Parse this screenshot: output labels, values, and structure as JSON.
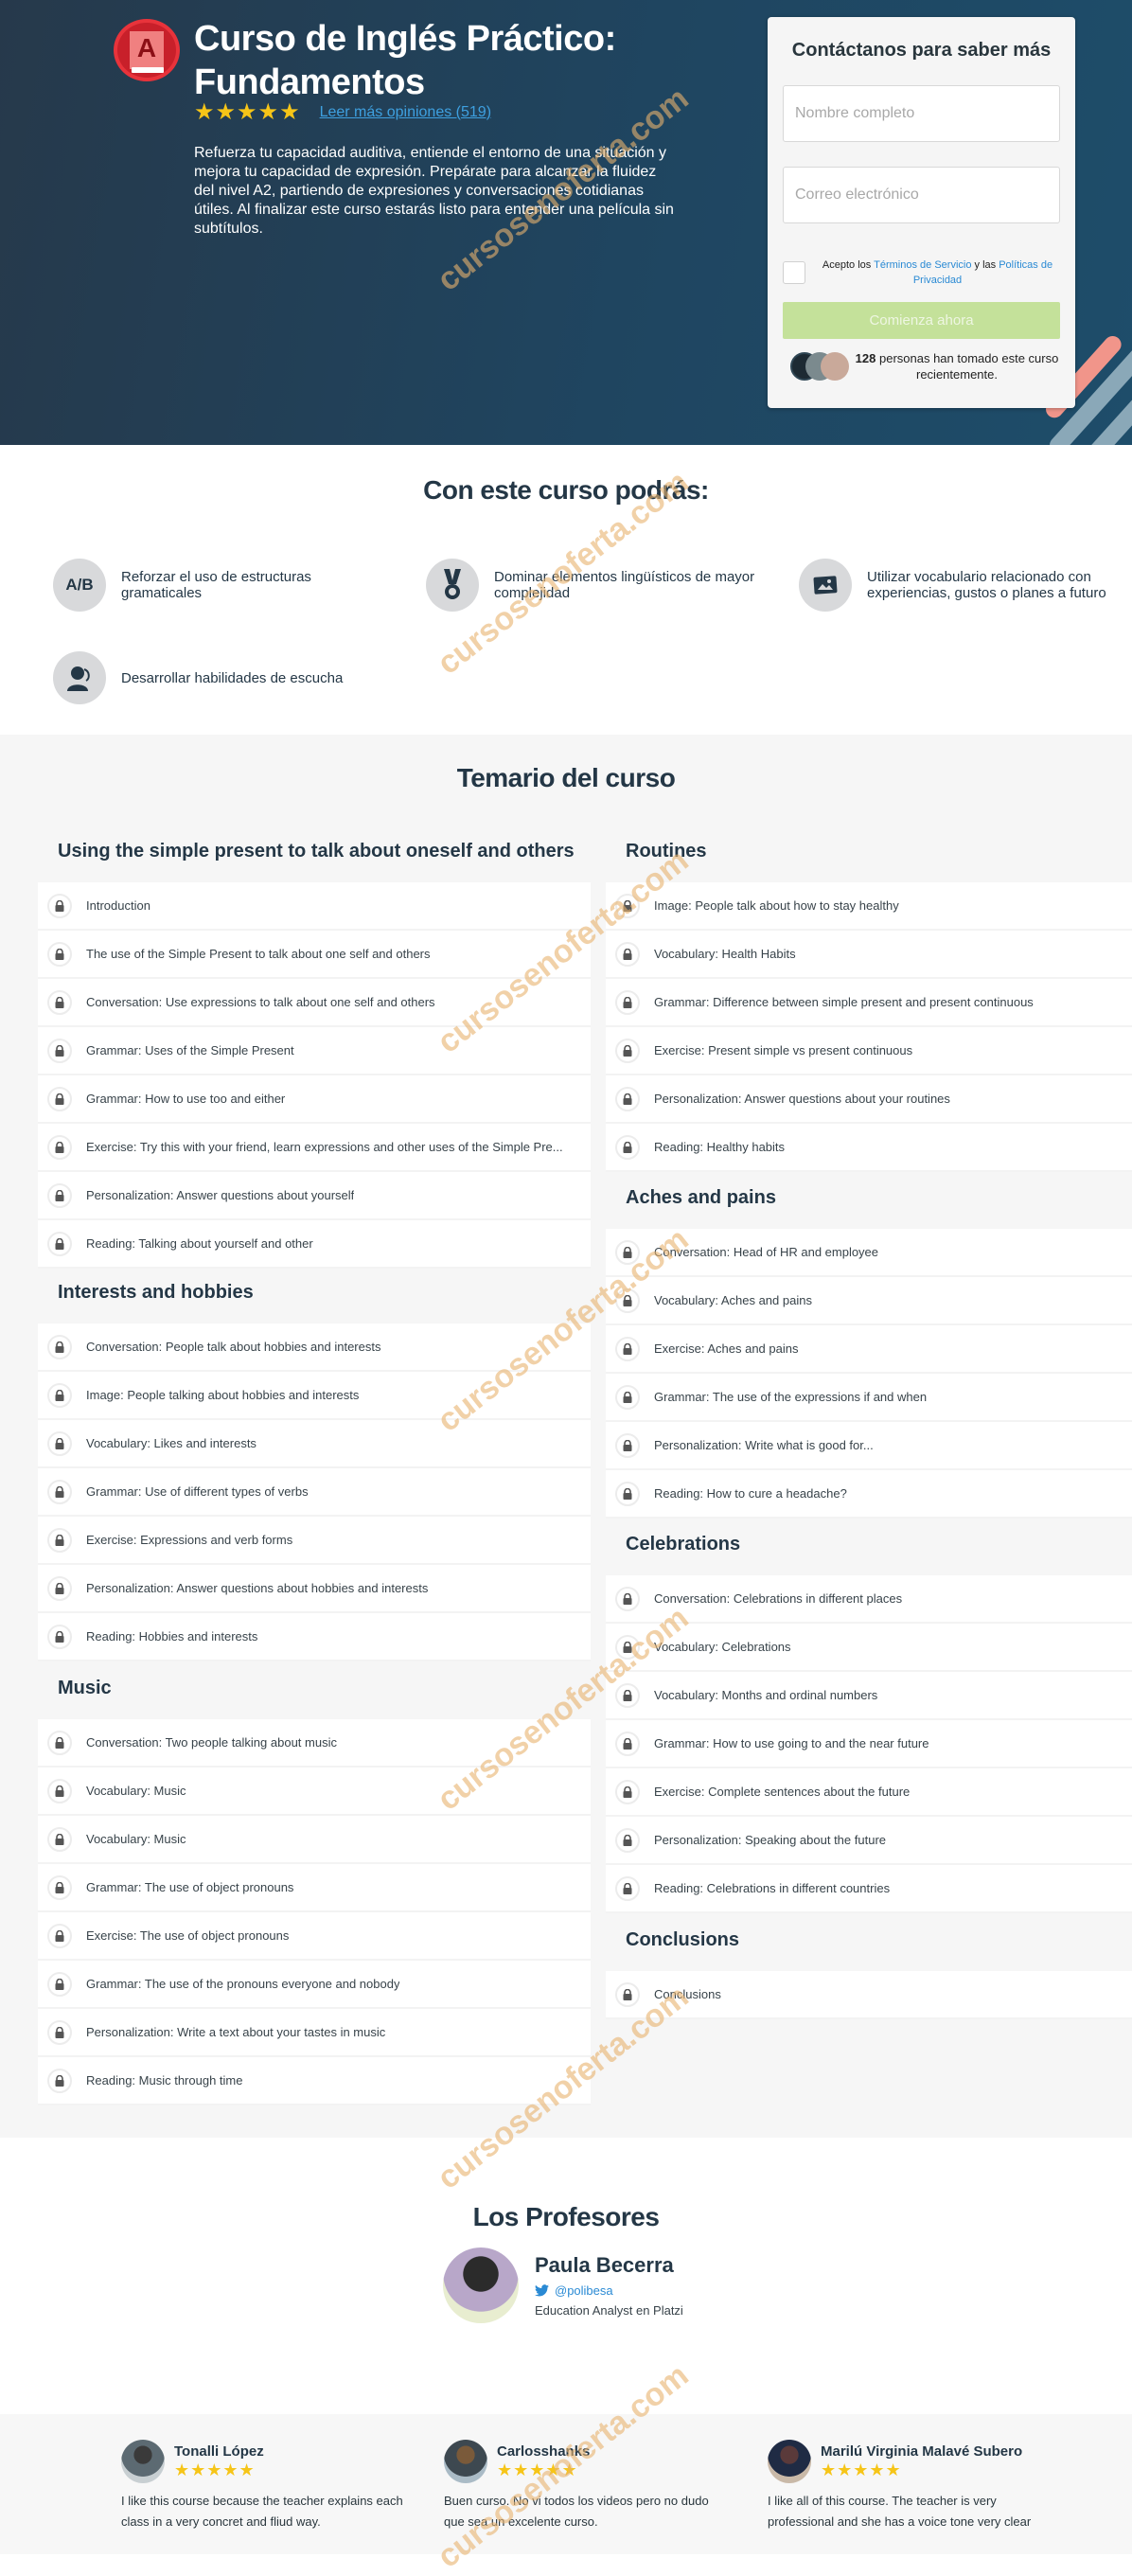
{
  "hero": {
    "logo_letter": "A",
    "title": "Curso de Inglés Práctico: Fundamentos",
    "stars": "★★★★★",
    "rating_value": 5,
    "reviews_link": "Leer más opiniones (519)",
    "description": "Refuerza tu capacidad auditiva, entiende el entorno de una situación y mejora tu capacidad de expresión. Prepárate para alcanzar la fluidez del nivel A2, partiendo de expresiones y conversaciones cotidianas útiles. Al finalizar este curso estarás listo para entender una película sin subtítulos."
  },
  "contact": {
    "title": "Contáctanos para saber más",
    "name_placeholder": "Nombre completo",
    "name_value": "",
    "email_placeholder": "Correo electrónico",
    "email_value": "",
    "terms_prefix": "Acepto los ",
    "terms_link": "Términos de Servicio",
    "terms_middle": " y las ",
    "privacy_link": "Políticas de Privacidad",
    "terms_checked": false,
    "submit_label": "Comienza ahora",
    "recent_count": "128",
    "recent_text": " personas han tomado este curso recientemente."
  },
  "skills": {
    "title": "Con este curso podrás:",
    "items": [
      {
        "icon": "ab-icon",
        "icon_text": "A/B",
        "label": "Reforzar el uso de estructuras gramaticales"
      },
      {
        "icon": "medal-icon",
        "label": "Dominar elementos lingüísticos de mayor complejidad"
      },
      {
        "icon": "picture-icon",
        "label": "Utilizar vocabulario relacionado con experiencias, gustos o planes a futuro"
      },
      {
        "icon": "listener-icon",
        "label": "Desarrollar habilidades de escucha"
      }
    ]
  },
  "syllabus": {
    "title": "Temario del curso",
    "modules": [
      {
        "title": "Using the simple present to talk about oneself and others",
        "lessons": [
          "Introduction",
          "The use of the Simple Present to talk about one self and others",
          "Conversation: Use expressions to talk about one self and others",
          "Grammar: Uses of the Simple Present",
          "Grammar: How to use too and either",
          "Exercise: Try this with your friend, learn expressions and other uses of the Simple Pre...",
          "Personalization: Answer questions about yourself",
          "Reading: Talking about yourself and other"
        ]
      },
      {
        "title": "Interests and hobbies",
        "lessons": [
          "Conversation: People talk about hobbies and interests",
          "Image: People talking about hobbies and interests",
          "Vocabulary: Likes and interests",
          "Grammar: Use of different types of verbs",
          "Exercise: Expressions and verb forms",
          "Personalization: Answer questions about hobbies and interests",
          "Reading: Hobbies and interests"
        ]
      },
      {
        "title": "Music",
        "lessons": [
          "Conversation: Two people talking about music",
          "Vocabulary: Music",
          "Vocabulary: Music",
          "Grammar: The use of object pronouns",
          "Exercise: The use of object pronouns",
          "Grammar: The use of the pronouns everyone and nobody",
          "Personalization: Write a text about your tastes in music",
          "Reading: Music through time"
        ]
      },
      {
        "title": "Routines",
        "lessons": [
          "Image: People talk about how to stay healthy",
          "Vocabulary: Health Habits",
          "Grammar: Difference between simple present and present continuous",
          "Exercise: Present simple vs present continuous",
          "Personalization: Answer questions about your routines",
          "Reading: Healthy habits"
        ]
      },
      {
        "title": "Aches and pains",
        "lessons": [
          "Conversation: Head of HR and employee",
          "Vocabulary: Aches and pains",
          "Exercise: Aches and pains",
          "Grammar: The use of the expressions if and when",
          "Personalization: Write what is good for...",
          "Reading: How to cure a headache?"
        ]
      },
      {
        "title": "Celebrations",
        "lessons": [
          "Conversation: Celebrations in different places",
          "Vocabulary: Celebrations",
          "Vocabulary: Months and ordinal numbers",
          "Grammar: How to use going to and the near future",
          "Exercise: Complete sentences about the future",
          "Personalization: Speaking about the future",
          "Reading: Celebrations in different countries"
        ]
      },
      {
        "title": "Conclusions",
        "lessons": [
          "Conclusions"
        ]
      }
    ]
  },
  "teachers": {
    "title": "Los Profesores",
    "items": [
      {
        "name": "Paula Becerra",
        "twitter": "@polibesa",
        "role": "Education Analyst en Platzi"
      }
    ]
  },
  "reviews": [
    {
      "name": "Tonalli López",
      "stars": "★★★★★",
      "rating": 5,
      "text": "I like this course because the teacher explains each class in a very concret and fliud way."
    },
    {
      "name": "Carlosshanks",
      "stars": "★★★★★",
      "rating": 5,
      "text": "Buen curso. No vi todos los videos pero no dudo que sea un excelente curso."
    },
    {
      "name": "Marilú Virginia Malavé Subero",
      "stars": "★★★★★",
      "rating": 5,
      "text": "I like all of this course. The teacher is very professional and she has a voice tone very clear"
    }
  ],
  "watermark": "cursosenoferta.com",
  "colors": {
    "hero_bg": "#1f4560",
    "accent_star": "#f6c518",
    "link": "#2a8ad4",
    "cta_disabled": "#c4e19a",
    "logo_red": "#c8202a",
    "heading": "#243746"
  }
}
